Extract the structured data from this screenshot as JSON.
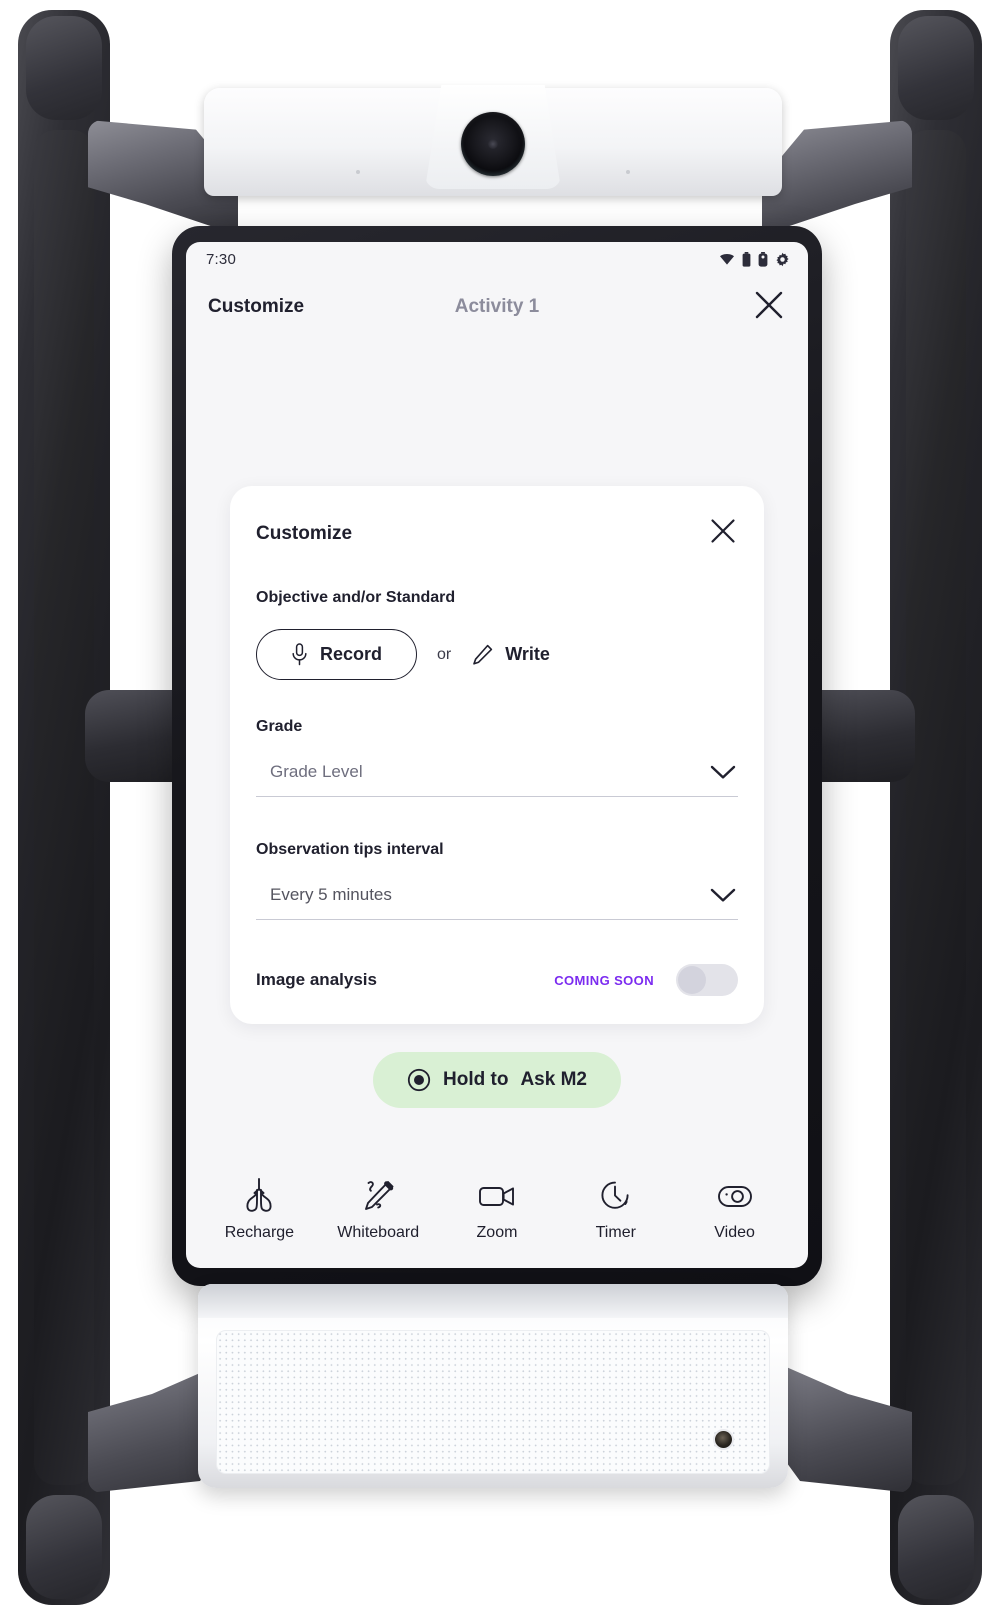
{
  "device": {
    "name": "classroom-robot-kiosk",
    "frame_color": "#1e1e23",
    "body_color": "#f5f6f8"
  },
  "screen": {
    "background": "#f6f6f8",
    "status_bar": {
      "time": "7:30",
      "icons": [
        "wifi-icon",
        "battery-icon",
        "battery-secondary-icon",
        "gear-icon"
      ]
    },
    "app_bar": {
      "title": "Customize",
      "activity": "Activity 1",
      "close_icon": "close-icon"
    },
    "card": {
      "title": "Customize",
      "close_icon": "close-icon",
      "objective": {
        "label": "Objective and/or Standard",
        "record_label": "Record",
        "record_icon": "microphone-icon",
        "or_label": "or",
        "write_label": "Write",
        "write_icon": "pencil-icon"
      },
      "grade": {
        "label": "Grade",
        "value": "Grade Level",
        "placeholder": "Grade Level",
        "chevron_icon": "chevron-down-icon"
      },
      "interval": {
        "label": "Observation tips interval",
        "value": "Every 5 minutes",
        "chevron_icon": "chevron-down-icon",
        "options": [
          "Every 5 minutes"
        ]
      },
      "image_analysis": {
        "label": "Image analysis",
        "badge": "COMING SOON",
        "badge_color": "#7B2BF0",
        "toggle_state": "off"
      }
    },
    "ask_button": {
      "prefix": "Hold to",
      "emphasis": "Ask M2",
      "icon": "record-dot-icon",
      "background": "#d9f0d4"
    },
    "bottom_nav": [
      {
        "label": "Recharge",
        "icon": "lungs-icon"
      },
      {
        "label": "Whiteboard",
        "icon": "magic-pencil-icon"
      },
      {
        "label": "Zoom",
        "icon": "video-camera-icon"
      },
      {
        "label": "Timer",
        "icon": "clock-icon"
      },
      {
        "label": "Video",
        "icon": "eye-lens-icon"
      }
    ]
  }
}
